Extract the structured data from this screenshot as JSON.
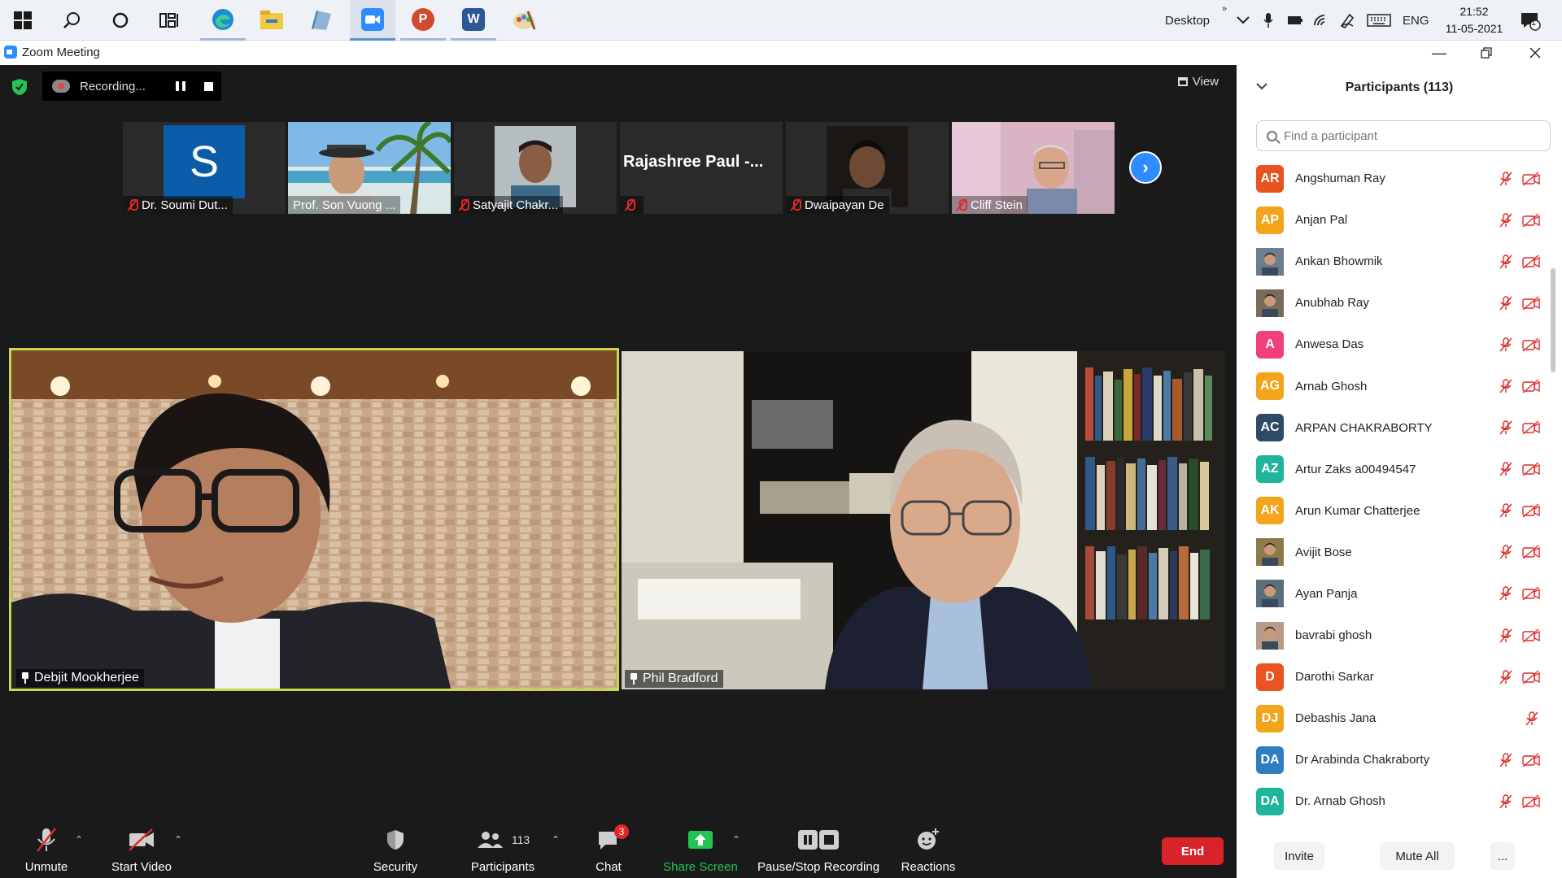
{
  "taskbar": {
    "apps": [
      "windows",
      "search",
      "cortana",
      "task-view",
      "edge",
      "file-explorer",
      "remote-desktop",
      "zoom",
      "powerpoint",
      "word",
      "paint"
    ],
    "desktop_label": "Desktop",
    "language": "ENG",
    "time": "21:52",
    "date": "11-05-2021",
    "notification_count": "1"
  },
  "window": {
    "title": "Zoom Meeting"
  },
  "meeting": {
    "recording_label": "Recording...",
    "view_label": "View",
    "thumbnails": [
      {
        "name": "Dr. Soumi Dut...",
        "initial": "S",
        "muted": true,
        "type": "avatar"
      },
      {
        "name": "Prof. Son Vuong ...",
        "muted": false,
        "type": "video"
      },
      {
        "name": "Satyajit Chakr...",
        "muted": true,
        "type": "video"
      },
      {
        "name": "",
        "display_name": "Rajashree  Paul  -...",
        "muted": true,
        "type": "name-only"
      },
      {
        "name": "Dwaipayan De",
        "muted": true,
        "type": "video"
      },
      {
        "name": "Cliff Stein",
        "muted": true,
        "type": "video"
      }
    ],
    "main_tiles": [
      {
        "name": "Debjit Mookherjee",
        "pinned": true,
        "active_speaker": true
      },
      {
        "name": "Phil Bradford",
        "pinned": true,
        "active_speaker": false
      }
    ]
  },
  "toolbar": {
    "unmute": "Unmute",
    "start_video": "Start Video",
    "security": "Security",
    "participants": "Participants",
    "participants_count": "113",
    "chat": "Chat",
    "chat_badge": "3",
    "share_screen": "Share Screen",
    "recording": "Pause/Stop Recording",
    "reactions": "Reactions",
    "end": "End"
  },
  "panel": {
    "title": "Participants (113)",
    "search_placeholder": "Find a participant",
    "participants": [
      {
        "name": "Angshuman Ray",
        "initials": "AR",
        "color": "#e8531f",
        "photo": false,
        "video": true
      },
      {
        "name": "Anjan Pal",
        "initials": "AP",
        "color": "#f2a41b",
        "photo": false,
        "video": true
      },
      {
        "name": "Ankan Bhowmik",
        "initials": "",
        "color": "#6b7d8e",
        "photo": true,
        "video": true
      },
      {
        "name": "Anubhab Ray",
        "initials": "",
        "color": "#7a6a5c",
        "photo": true,
        "video": true
      },
      {
        "name": "Anwesa Das",
        "initials": "A",
        "color": "#f0407a",
        "photo": false,
        "video": true
      },
      {
        "name": "Arnab Ghosh",
        "initials": "AG",
        "color": "#f2a41b",
        "photo": false,
        "video": true
      },
      {
        "name": "ARPAN CHAKRABORTY",
        "initials": "AC",
        "color": "#2e4a66",
        "photo": false,
        "video": true
      },
      {
        "name": "Artur Zaks a00494547",
        "initials": "AZ",
        "color": "#1fb59c",
        "photo": false,
        "video": true
      },
      {
        "name": "Arun Kumar Chatterjee",
        "initials": "AK",
        "color": "#f2a41b",
        "photo": false,
        "video": true
      },
      {
        "name": "Avijit Bose",
        "initials": "",
        "color": "#8c7a4a",
        "photo": true,
        "video": true
      },
      {
        "name": "Ayan Panja",
        "initials": "",
        "color": "#5a6f7a",
        "photo": true,
        "video": true
      },
      {
        "name": "bavrabi ghosh",
        "initials": "",
        "color": "#b99a8a",
        "photo": true,
        "video": true
      },
      {
        "name": "Darothi Sarkar",
        "initials": "D",
        "color": "#e8531f",
        "photo": false,
        "video": true
      },
      {
        "name": "Debashis Jana",
        "initials": "DJ",
        "color": "#f2a41b",
        "photo": false,
        "video": false
      },
      {
        "name": "Dr Arabinda Chakraborty",
        "initials": "DA",
        "color": "#2d7fc1",
        "photo": false,
        "video": true
      },
      {
        "name": "Dr. Arnab Ghosh",
        "initials": "DA",
        "color": "#1fb59c",
        "photo": false,
        "video": true
      }
    ],
    "invite": "Invite",
    "mute_all": "Mute All",
    "more": "..."
  }
}
